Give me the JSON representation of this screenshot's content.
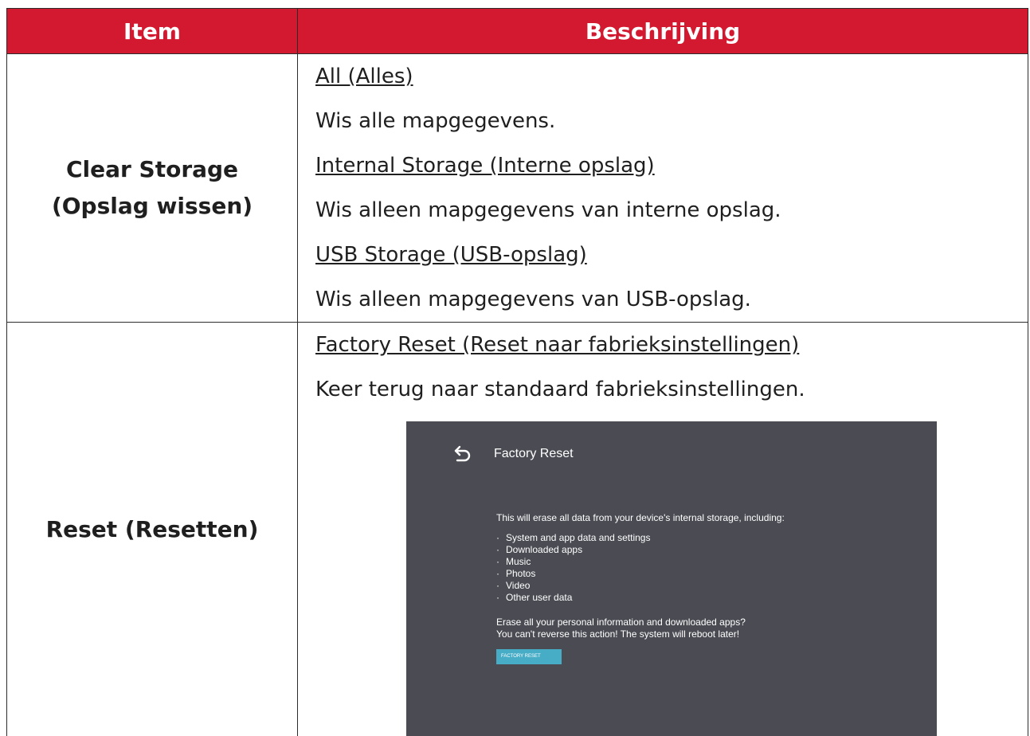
{
  "table": {
    "header": {
      "item": "Item",
      "description": "Beschrijving"
    },
    "rows": [
      {
        "item_line1": "Clear Storage",
        "item_line2": "(Opslag wissen)",
        "options": [
          {
            "title": "All (Alles)",
            "desc": "Wis alle mapgegevens."
          },
          {
            "title": "Internal Storage (Interne opslag)",
            "desc": "Wis alleen mapgegevens van interne opslag."
          },
          {
            "title": "USB Storage (USB-opslag)",
            "desc": "Wis alleen mapgegevens van USB-opslag."
          }
        ]
      },
      {
        "item": "Reset (Resetten)",
        "options": [
          {
            "title": "Factory Reset (Reset naar fabrieksinstellingen)",
            "desc": "Keer terug naar standaard fabrieksinstellingen."
          }
        ]
      }
    ]
  },
  "screenshot": {
    "title": "Factory Reset",
    "intro": "This will erase all data from your device's internal storage, including:",
    "items": [
      "System and app data and settings",
      "Downloaded apps",
      "Music",
      "Photos",
      "Video",
      "Other user data"
    ],
    "question": "Erase all your personal information and downloaded apps?",
    "warning": "You can't reverse this action! The system will reboot later!",
    "button_label": "FACTORY RESET",
    "icons": {
      "back": "back-arrow-icon"
    },
    "colors": {
      "background": "#4a4b53",
      "button": "#47adc7"
    }
  },
  "colors": {
    "header_bg": "#d3192f",
    "header_text": "#ffffff"
  }
}
